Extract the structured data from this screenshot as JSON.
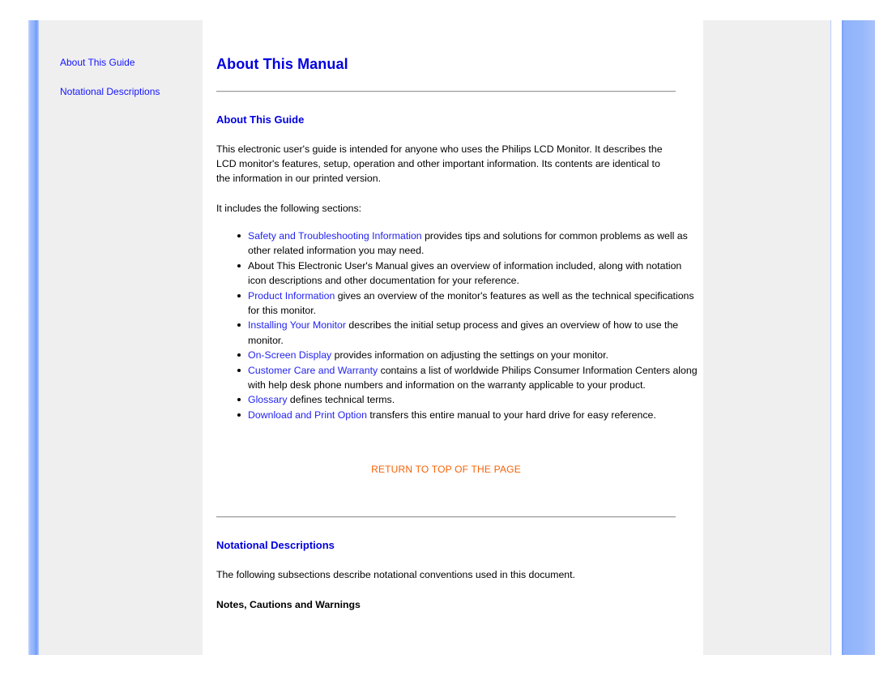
{
  "document": {
    "title": "About This Manual"
  },
  "sidebar": {
    "links": [
      {
        "label": "About This Guide"
      },
      {
        "label": "Notational Descriptions"
      }
    ]
  },
  "main": {
    "page_title": "About This Manual",
    "sections": [
      {
        "heading": "About This Guide",
        "paragraph1": "This electronic user's guide is intended for anyone who uses the Philips LCD Monitor. It describes the LCD monitor's features, setup, operation and other important information. Its contents are identical to the information in our printed version.",
        "paragraph2": "It includes the following sections:",
        "bullets": [
          {
            "link": "Safety and Troubleshooting Information",
            "text": " provides tips and solutions for common problems as well as other related information you may need."
          },
          {
            "link": "",
            "text": "About This Electronic User's Manual gives an overview of information included, along with notation icon descriptions and other documentation for your reference."
          },
          {
            "link": "Product Information",
            "text": " gives an overview of the monitor's features as well as the technical specifications for this monitor."
          },
          {
            "link": "Installing Your Monitor",
            "text": " describes the initial setup process and gives an overview of how to use the monitor."
          },
          {
            "link": "On-Screen Display",
            "text": " provides information on adjusting the settings on your monitor."
          },
          {
            "link": "Customer Care and Warranty",
            "text": " contains a list of worldwide Philips Consumer Information Centers along with help desk phone numbers and information on the warranty applicable to your product."
          },
          {
            "link": "Glossary",
            "text": " defines technical terms."
          },
          {
            "link": "Download and Print Option",
            "text": " transfers this entire manual to your hard drive for easy reference."
          }
        ],
        "return_to_top": "RETURN TO TOP OF THE PAGE"
      },
      {
        "heading": "Notational Descriptions",
        "paragraph1": "The following subsections describe notational conventions used in this document.",
        "subheading": "Notes, Cautions and Warnings"
      }
    ]
  },
  "colors": {
    "heading_blue": "#0000e0",
    "link_blue": "#2323f0",
    "sidebar_link_blue": "#1414ff",
    "return_orange": "#f96104",
    "panel_gray": "#efeff0",
    "accent_bar_blue": "#8fb2fb"
  }
}
